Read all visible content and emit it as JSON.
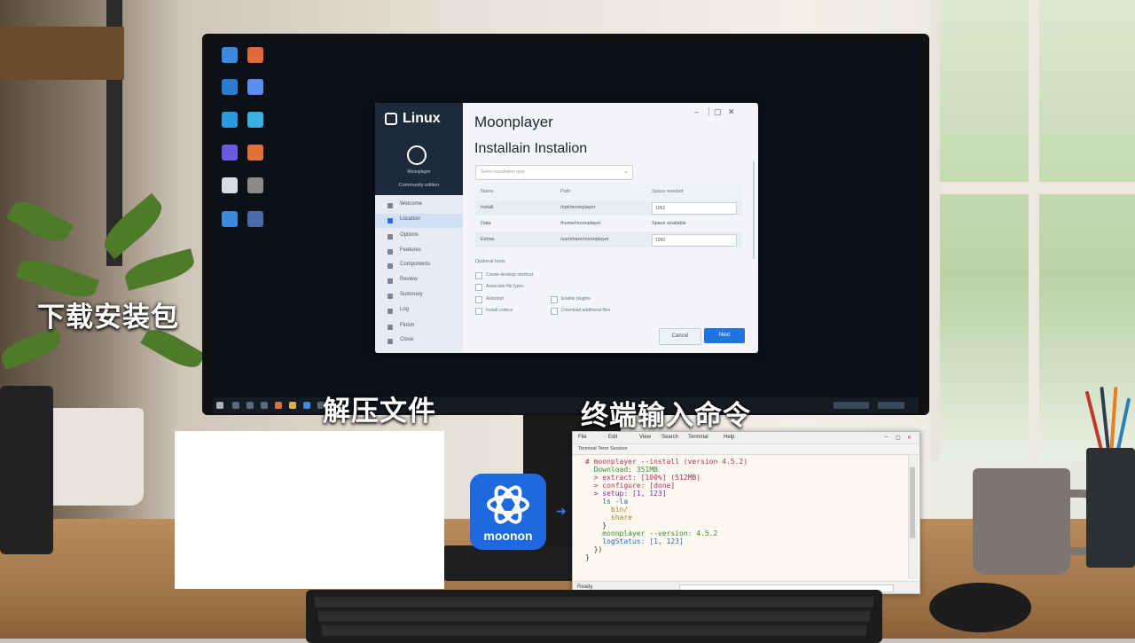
{
  "captions": {
    "step1": "下载安装包",
    "step2": "解压文件",
    "step3": "终端输入命令"
  },
  "desktop_icons": [
    "",
    "",
    "",
    "",
    "",
    "",
    "",
    "",
    "",
    "",
    "",
    ""
  ],
  "installer": {
    "brand": "Linux",
    "app_name": "Moonplayer",
    "subtitle": "Installain Instalion",
    "logo_caption": "Moonplayer",
    "side_heading": "Community edition",
    "side_items": [
      "Welcome",
      "Location",
      "Options",
      "Features",
      "Components",
      "Review",
      "Summary",
      "Log",
      "Finish",
      "Close"
    ],
    "active_side_index": 1,
    "select_placeholder": "Select installation type",
    "table_headers": [
      "Name",
      "Path",
      "Space needed"
    ],
    "table_rows": [
      {
        "name": "Install",
        "path": "/opt/moonplayer",
        "size": "1062"
      },
      {
        "name": "Data",
        "path": "/home/moonplayer",
        "size": "Space available"
      },
      {
        "name": "Extras",
        "path": "/usr/share/moonplayer",
        "size": "1060"
      }
    ],
    "options_heading": "Optional tools",
    "checkboxes": [
      "Create desktop shortcut",
      "Associate file types",
      "Autostart",
      "Enable plugins",
      "Install codecs",
      "Download additional files"
    ],
    "cancel_label": "Cancel",
    "next_label": "Next",
    "window_controls": [
      "–",
      "▢",
      "✕"
    ]
  },
  "app_icon": {
    "label": "moonon",
    "color": "#1e68e0"
  },
  "terminal": {
    "menu": [
      "File",
      "Edit",
      "View",
      "Search",
      "Terminal",
      "Help"
    ],
    "tab_label": "Terminal Term Session",
    "lines": [
      {
        "text": "# moonplayer --install (version 4.5.2)",
        "color": "#b03060",
        "indent": 0
      },
      {
        "text": "  Download: 351MB",
        "color": "#3a8a3a",
        "indent": 0
      },
      {
        "text": "  > extract: [100%] (512MB)",
        "color": "#b03060",
        "indent": 0
      },
      {
        "text": "  > configure: [done]",
        "color": "#b03060",
        "indent": 0
      },
      {
        "text": "  > setup: [1, 123]",
        "color": "#7a2ab0",
        "indent": 0
      },
      {
        "text": "    ls -la",
        "color": "#2a6ab0",
        "indent": 0
      },
      {
        "text": "      bin/",
        "color": "#b07a20",
        "indent": 0
      },
      {
        "text": "      share",
        "color": "#b07a20",
        "indent": 0
      },
      {
        "text": "    }",
        "color": "#333333",
        "indent": 0
      },
      {
        "text": "    moonplayer --version: 4.5.2",
        "color": "#3a8a3a",
        "indent": 0
      },
      {
        "text": "    logStatus: [1, 123]",
        "color": "#2a6ab0",
        "indent": 0
      },
      {
        "text": "  })",
        "color": "#333333",
        "indent": 0
      },
      {
        "text": "}",
        "color": "#333333",
        "indent": 0
      }
    ],
    "status_left": "Ready"
  }
}
